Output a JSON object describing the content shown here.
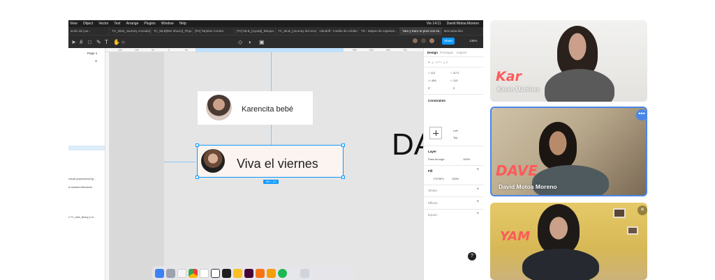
{
  "menubar": {
    "items": [
      "View",
      "Object",
      "Vector",
      "Text",
      "Arrange",
      "Plugins",
      "Window",
      "Help"
    ],
    "clock": "Vie 14:11",
    "user": "David Motoa Moreno"
  },
  "tabs": [
    {
      "label": "ación de jour..."
    },
    {
      "label": "TC_MLB_Journey cruzado]..."
    },
    {
      "label": "TC_MLB[Mer ahorro]_Flujo..."
    },
    {
      "label": "[PA] Tarjetas Combo"
    },
    {
      "label": "[TC] MLB_[Ayuda]_Bloque..."
    },
    {
      "label": "TC_MLB_[Journey del secu..."
    },
    {
      "label": "Handoff - Cartão de crédito"
    },
    {
      "label": "TD - Mapeo de experien..."
    },
    {
      "label": "Yam y Karo re pros con es..."
    },
    {
      "label": "MercadoLibre"
    }
  ],
  "toolbar": {
    "share_label": "Share",
    "zoom": "136%"
  },
  "left_panel": {
    "page_label": "Page 1",
    "add_icon": "+",
    "layers": [
      "ctnudo proporcional Ag...",
      "la muestra internando ...",
      "e TC_main_library y cri..."
    ]
  },
  "ruler": {
    "ticks": [
      "150",
      "100",
      "50",
      "0",
      "50",
      "100",
      "150",
      "200",
      "250",
      "300",
      "350",
      "400",
      "450",
      "508",
      "550",
      "600",
      "650",
      "700",
      "750"
    ]
  },
  "canvas": {
    "card1_name": "Karencita bebé",
    "card2_name": "Viva el viernes",
    "size_badge": "408 × 114",
    "big_text": "DA"
  },
  "right_panel": {
    "tabs": [
      "Design",
      "Prototype",
      "Inspect"
    ],
    "x_label": "X",
    "x_value": "112",
    "y_label": "Y",
    "y_value": "1171",
    "w_label": "W",
    "w_value": "408",
    "h_label": "H",
    "h_value": "113",
    "rot_value": "0°",
    "radius_value": "0",
    "constraints_title": "Constraints",
    "constraint_h": "Left",
    "constraint_v": "Top",
    "layer_title": "Layer",
    "blend_mode": "Pass through",
    "opacity": "100%",
    "fill_title": "Fill",
    "fill_hex": "FCF6F4",
    "fill_opacity": "100%",
    "stroke_title": "Stroke",
    "effects_title": "Effects",
    "export_title": "Export",
    "help": "?"
  },
  "participants": [
    {
      "name": "Karen Martinez",
      "scribble": "Kar"
    },
    {
      "name": "David Motoa Moreno",
      "scribble": "DAVE"
    },
    {
      "name": "",
      "scribble": "YAM"
    }
  ],
  "icons": {
    "more": "more-horizontal-icon",
    "mute": "mic-off-icon"
  }
}
